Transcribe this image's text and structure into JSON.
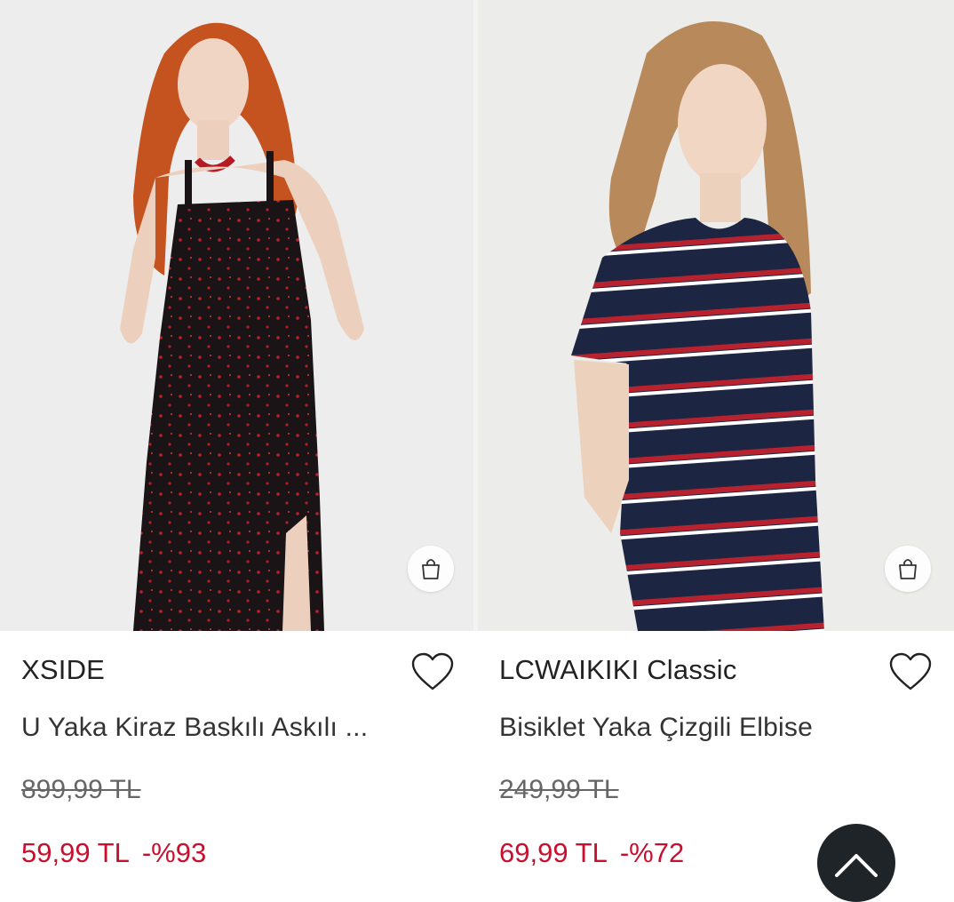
{
  "products": [
    {
      "brand": "XSIDE",
      "title": "U Yaka Kiraz Baskılı Askılı ...",
      "old_price": "899,99 TL",
      "new_price": "59,99 TL",
      "discount": "-%93",
      "icons": {
        "favorite": "heart-outline-icon",
        "cart": "shopping-bag-icon"
      }
    },
    {
      "brand": "LCWAIKIKI Classic",
      "title": "Bisiklet Yaka Çizgili Elbise",
      "old_price": "249,99 TL",
      "new_price": "69,99 TL",
      "discount": "-%72",
      "icons": {
        "favorite": "heart-outline-icon",
        "cart": "shopping-bag-icon"
      }
    }
  ],
  "scroll_top": {
    "icon": "chevron-up-icon"
  },
  "colors": {
    "sale": "#c8102e",
    "text": "#222222",
    "strike": "#666666",
    "fab": "#1e2428"
  }
}
